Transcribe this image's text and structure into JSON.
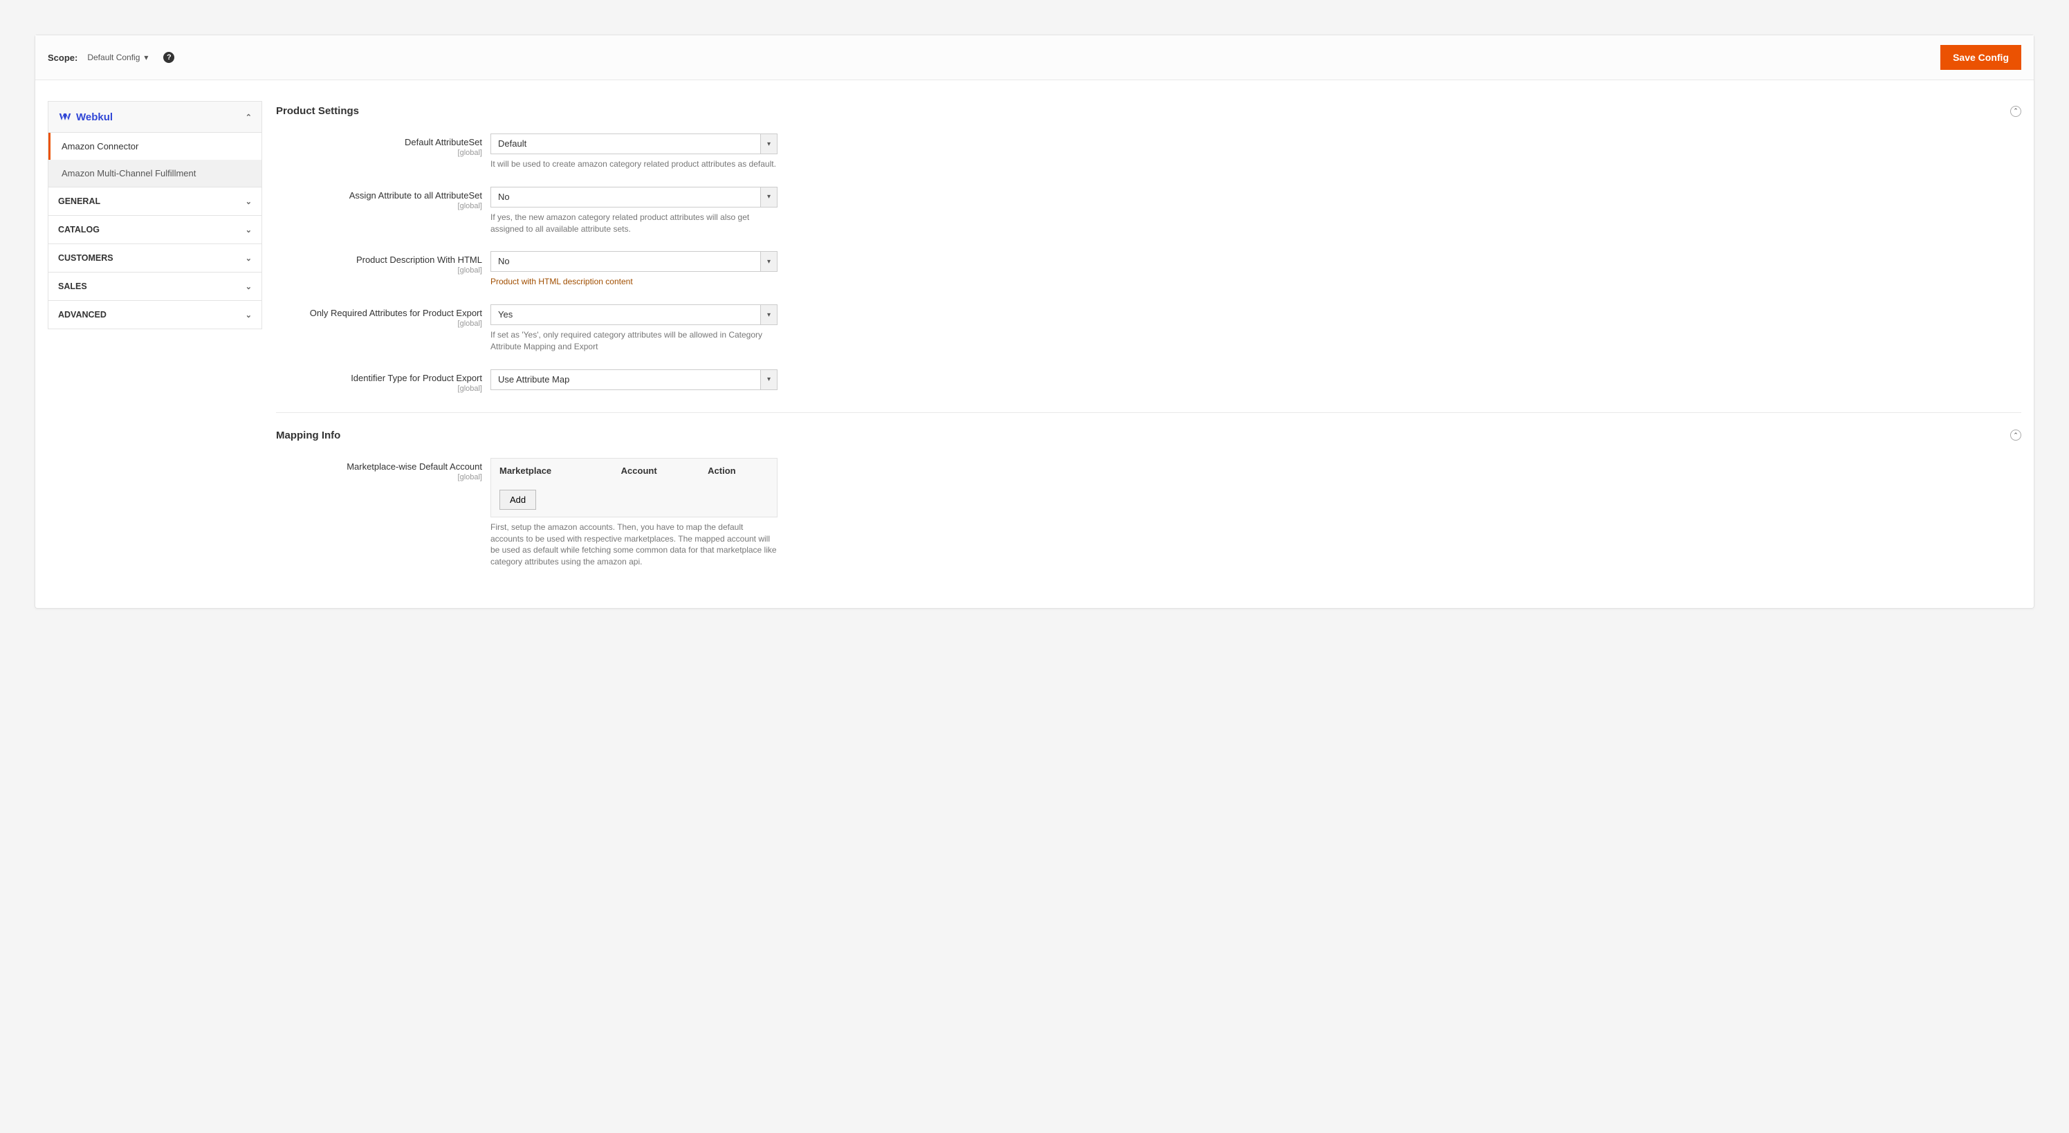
{
  "header": {
    "scope_label": "Scope:",
    "scope_value": "Default Config",
    "save_button": "Save Config"
  },
  "sidebar": {
    "brand": "Webkul",
    "sub_items": [
      {
        "label": "Amazon Connector",
        "active": true
      },
      {
        "label": "Amazon Multi-Channel Fulfillment",
        "active": false
      }
    ],
    "categories": [
      "GENERAL",
      "CATALOG",
      "CUSTOMERS",
      "SALES",
      "ADVANCED"
    ]
  },
  "sections": {
    "product_settings": {
      "title": "Product Settings",
      "fields": {
        "default_attrset": {
          "label": "Default AttributeSet",
          "scope": "[global]",
          "value": "Default",
          "note": "It will be used to create amazon category related product attributes as default."
        },
        "assign_attr": {
          "label": "Assign Attribute to all AttributeSet",
          "scope": "[global]",
          "value": "No",
          "note": "If yes, the new amazon category related product attributes will also get assigned to all available attribute sets."
        },
        "desc_html": {
          "label": "Product Description With HTML",
          "scope": "[global]",
          "value": "No",
          "note": "Product with HTML description content"
        },
        "required_only": {
          "label": "Only Required Attributes for Product Export",
          "scope": "[global]",
          "value": "Yes",
          "note": "If set as 'Yes', only required category attributes will be allowed in Category Attribute Mapping and Export"
        },
        "identifier": {
          "label": "Identifier Type for Product Export",
          "scope": "[global]",
          "value": "Use Attribute Map"
        }
      }
    },
    "mapping_info": {
      "title": "Mapping Info",
      "field": {
        "label": "Marketplace-wise Default Account",
        "scope": "[global]",
        "columns": [
          "Marketplace",
          "Account",
          "Action"
        ],
        "add_button": "Add",
        "note": "First, setup the amazon accounts. Then, you have to map the default accounts to be used with respective marketplaces. The mapped account will be used as default while fetching some common data for that marketplace like category attributes using the amazon api."
      }
    }
  }
}
